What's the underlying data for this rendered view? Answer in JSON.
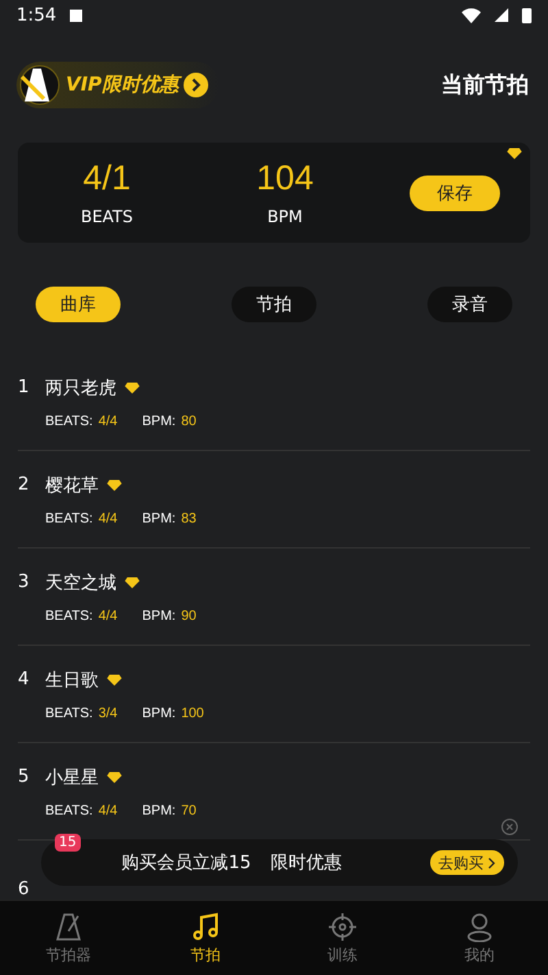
{
  "status_bar": {
    "time": "1:54"
  },
  "header": {
    "vip_label": "VIP限时优惠",
    "title": "当前节拍"
  },
  "current": {
    "beats": "4/1",
    "beats_label": "BEATS",
    "bpm": "104",
    "bpm_label": "BPM",
    "save": "保存"
  },
  "tabs": [
    {
      "label": "曲库",
      "selected": true
    },
    {
      "label": "节拍",
      "selected": false
    },
    {
      "label": "录音",
      "selected": false
    }
  ],
  "songs": [
    {
      "index": "1",
      "title": "两只老虎",
      "beats_label": "BEATS:",
      "beats": "4/4",
      "bpm_label": "BPM:",
      "bpm": "80"
    },
    {
      "index": "2",
      "title": "樱花草",
      "beats_label": "BEATS:",
      "beats": "4/4",
      "bpm_label": "BPM:",
      "bpm": "83"
    },
    {
      "index": "3",
      "title": "天空之城",
      "beats_label": "BEATS:",
      "beats": "4/4",
      "bpm_label": "BPM:",
      "bpm": "90"
    },
    {
      "index": "4",
      "title": "生日歌",
      "beats_label": "BEATS:",
      "beats": "3/4",
      "bpm_label": "BPM:",
      "bpm": "100"
    },
    {
      "index": "5",
      "title": "小星星",
      "beats_label": "BEATS:",
      "beats": "4/4",
      "bpm_label": "BPM:",
      "bpm": "70"
    },
    {
      "index": "6"
    }
  ],
  "ad_banner": {
    "badge": "15",
    "text": "购买会员立减15",
    "tag": "限时优惠",
    "button": "去购买"
  },
  "nav": [
    {
      "label": "节拍器",
      "selected": false,
      "kind": "metronome"
    },
    {
      "label": "节拍",
      "selected": true,
      "kind": "music"
    },
    {
      "label": "训练",
      "selected": false,
      "kind": "target"
    },
    {
      "label": "我的",
      "selected": false,
      "kind": "person"
    }
  ]
}
